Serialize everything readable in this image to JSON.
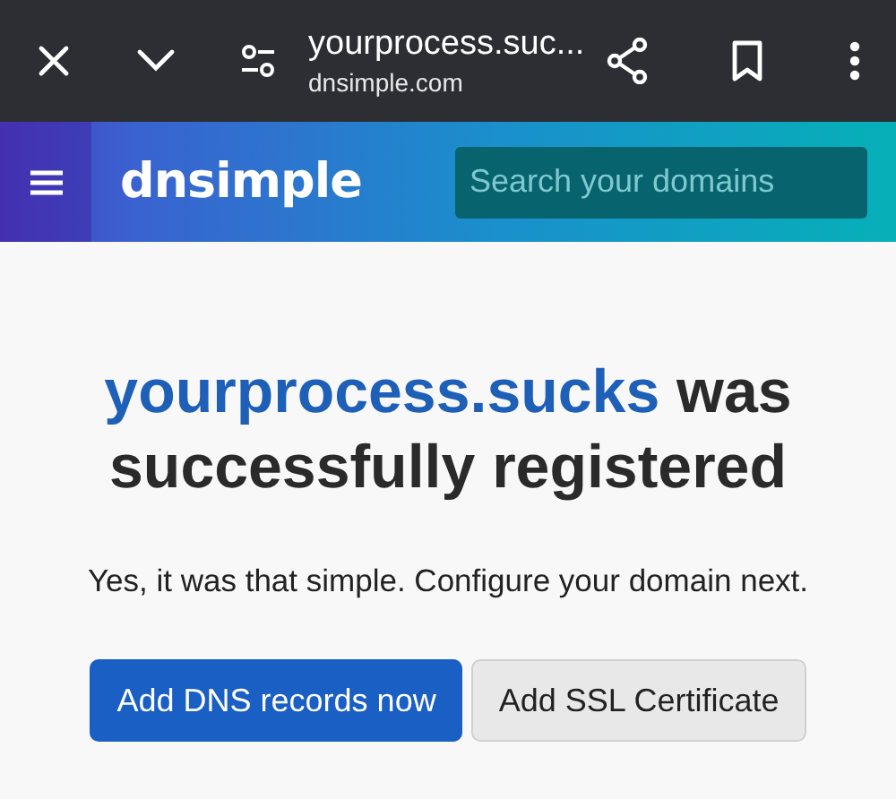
{
  "browser_bar": {
    "title": "yourprocess.suc...",
    "url": "dnsimple.com"
  },
  "nav": {
    "logo": "dnsimple",
    "search": {
      "placeholder": "Search your domains"
    }
  },
  "heading": {
    "domain": "yourprocess.sucks",
    "text": " was successfully registered"
  },
  "message": "Yes, it was that simple. Configure your domain next.",
  "buttons": [
    {
      "label": "Add DNS records now",
      "kind": "primary"
    },
    {
      "label": "Add SSL Certificate",
      "kind": "secondary"
    }
  ]
}
